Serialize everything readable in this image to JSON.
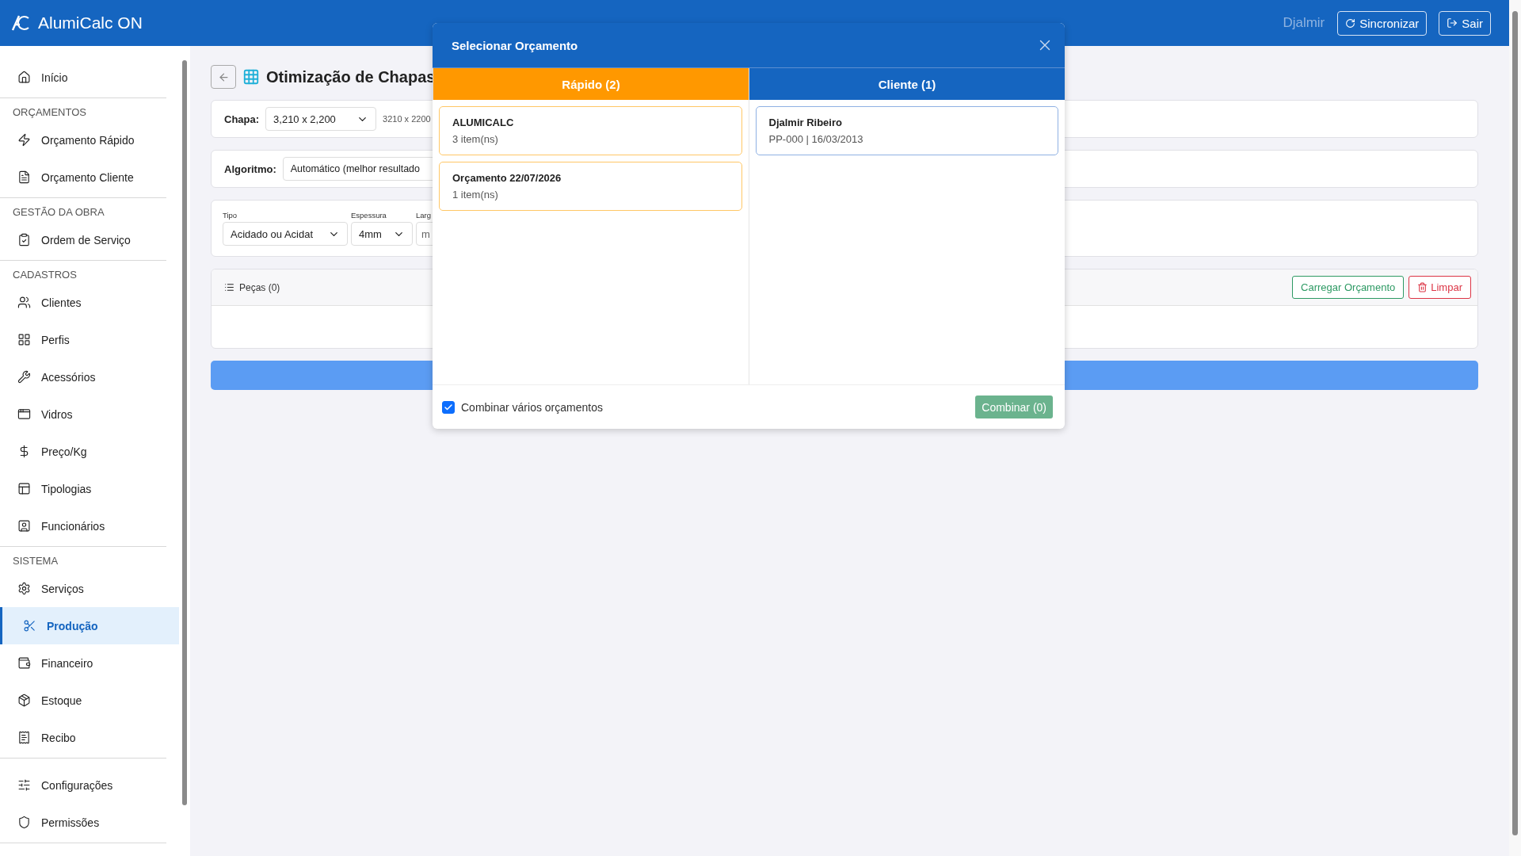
{
  "header": {
    "app_name": "AlumiCalc ON",
    "user": "Djalmir",
    "buttons": [
      {
        "label": "Sincronizar"
      },
      {
        "label": "Sair"
      }
    ]
  },
  "sidebar": {
    "sections": [
      {
        "items": [
          {
            "label": "Início",
            "selected": false
          }
        ]
      },
      {
        "heading": "ORÇAMENTOS",
        "items": [
          {
            "label": "Orçamento Rápido",
            "selected": false
          },
          {
            "label": "Orçamento Cliente",
            "selected": false
          }
        ]
      },
      {
        "heading": "GESTÃO DA OBRA",
        "items": [
          {
            "label": "Ordem de Serviço",
            "selected": false
          }
        ]
      },
      {
        "heading": "CADASTROS",
        "items": [
          {
            "label": "Clientes",
            "selected": false
          },
          {
            "label": "Perfis",
            "selected": false
          },
          {
            "label": "Acessórios",
            "selected": false
          },
          {
            "label": "Vidros",
            "selected": false
          },
          {
            "label": "Preço/Kg",
            "selected": false
          },
          {
            "label": "Tipologias",
            "selected": false
          },
          {
            "label": "Funcionários",
            "selected": false
          }
        ]
      },
      {
        "heading": "SISTEMA",
        "items": [
          {
            "label": "Serviços",
            "selected": false
          },
          {
            "label": "Produção",
            "selected": true
          },
          {
            "label": "Financeiro",
            "selected": false
          },
          {
            "label": "Estoque",
            "selected": false
          },
          {
            "label": "Recibo",
            "selected": false
          }
        ]
      },
      {
        "items": [
          {
            "label": "Configurações",
            "selected": false
          },
          {
            "label": "Permissões",
            "selected": false
          }
        ]
      }
    ]
  },
  "page": {
    "title": "Otimização de Chapas",
    "chapa": {
      "label": "Chapa:",
      "value": "3,210 x 2,200",
      "size_note": "3210 x 2200"
    },
    "algoritmo": {
      "label": "Algoritmo:",
      "value": "Automático (melhor resultado"
    },
    "fields": [
      {
        "label": "Tipo",
        "kind": "select",
        "value": "Acidado ou Acidat"
      },
      {
        "label": "Espessura",
        "kind": "select",
        "value": "4mm"
      },
      {
        "label": "Larg",
        "kind": "input",
        "value": "m"
      }
    ],
    "pieces": {
      "title": "Peças (0)",
      "buttons": [
        {
          "label": "Carregar Orçamento",
          "kind": "load"
        },
        {
          "label": "Limpar",
          "kind": "clear"
        }
      ]
    }
  },
  "modal": {
    "title": "Selecionar Orçamento",
    "tabs": [
      {
        "label": "Rápido (2)",
        "selected": true
      },
      {
        "label": "Cliente (1)",
        "selected": false
      }
    ],
    "columns": [
      [
        {
          "title": "ALUMICALC",
          "subtitle": "3 item(ns)"
        },
        {
          "title": "Orçamento 22/07/2026",
          "subtitle": "1 item(ns)"
        }
      ],
      [
        {
          "title": "Djalmir Ribeiro",
          "subtitle": "PP-000 | 16/03/2013"
        }
      ]
    ],
    "combine": {
      "label": "Combinar vários orçamentos",
      "checked": true
    },
    "combine_button": "Combinar (0)"
  }
}
